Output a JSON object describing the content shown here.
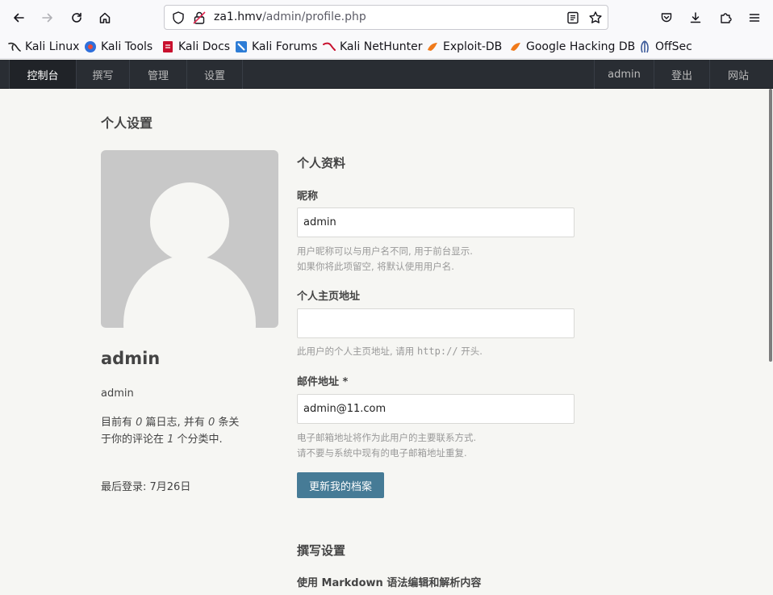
{
  "browser": {
    "url_host": "za1.hmv",
    "url_path": "/admin/profile.php",
    "bookmarks": [
      {
        "label": "Kali Linux",
        "icon": "kali-dragon-icon"
      },
      {
        "label": "Kali Tools",
        "icon": "kali-tools-icon"
      },
      {
        "label": "Kali Docs",
        "icon": "kali-docs-icon"
      },
      {
        "label": "Kali Forums",
        "icon": "kali-forums-icon"
      },
      {
        "label": "Kali NetHunter",
        "icon": "kali-nethunter-icon"
      },
      {
        "label": "Exploit-DB",
        "icon": "exploit-db-icon"
      },
      {
        "label": "Google Hacking DB",
        "icon": "ghdb-icon"
      },
      {
        "label": "OffSec",
        "icon": "offsec-icon"
      }
    ]
  },
  "nav": {
    "left": [
      "控制台",
      "撰写",
      "管理",
      "设置"
    ],
    "right": [
      "admin",
      "登出",
      "网站"
    ]
  },
  "page": {
    "title": "个人设置"
  },
  "profile": {
    "name": "admin",
    "username": "admin",
    "stats_prefix": "目前有 ",
    "posts_count": "0",
    "stats_mid": " 篇日志, 并有 ",
    "comments_count": "0",
    "stats_mid2": " 条关于你的评论在 ",
    "categories_count": "1",
    "stats_suffix": " 个分类中.",
    "last_login": "最后登录: 7月26日"
  },
  "form": {
    "section_title": "个人资料",
    "nickname_label": "昵称",
    "nickname_value": "admin",
    "nickname_hint_1": "用户昵称可以与用户名不同, 用于前台显示.",
    "nickname_hint_2": "如果你将此项留空, 将默认使用用户名.",
    "homepage_label": "个人主页地址",
    "homepage_value": "",
    "homepage_hint_prefix": "此用户的个人主页地址, 请用 ",
    "homepage_hint_code": "http://",
    "homepage_hint_suffix": " 开头.",
    "email_label": "邮件地址 *",
    "email_value": "admin@11.com",
    "email_hint_1": "电子邮箱地址将作为此用户的主要联系方式.",
    "email_hint_2": "请不要与系统中现有的电子邮箱地址重复.",
    "submit_label": "更新我的档案"
  },
  "writing": {
    "section_title": "撰写设置",
    "markdown_label": "使用 Markdown 语法编辑和解析内容"
  },
  "colors": {
    "nav_bg": "#292d33",
    "button": "#467b96",
    "page_bg": "#f6f6f3"
  }
}
